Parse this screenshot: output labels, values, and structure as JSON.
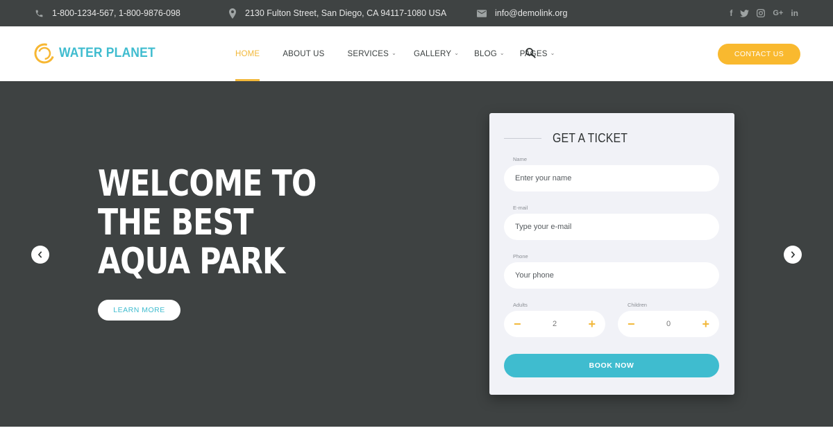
{
  "topbar": {
    "phone": "1-800-1234-567,  1-800-9876-098",
    "address": "2130 Fulton Street, San Diego, CA 94117-1080 USA",
    "email": "info@demolink.org",
    "social_icons": [
      "facebook-icon",
      "twitter-icon",
      "instagram-icon",
      "google-plus-icon",
      "linkedin-icon"
    ],
    "social_glyphs": {
      "facebook": "f",
      "googleplus": "G+",
      "linkedin": "in"
    }
  },
  "header": {
    "logo_text": "WATER PLANET",
    "nav": [
      {
        "label": "HOME",
        "active": true
      },
      {
        "label": "ABOUT US"
      },
      {
        "label": "SERVICES",
        "dropdown": true
      },
      {
        "label": "GALLERY",
        "dropdown": true
      },
      {
        "label": "BLOG",
        "dropdown": true
      },
      {
        "label": "PAGES",
        "dropdown": true
      }
    ],
    "contact_label": "CONTACT US"
  },
  "hero": {
    "title_line1": "WELCOME TO",
    "title_line2": "THE BEST",
    "title_line3": "AQUA PARK",
    "learn_more_label": "LEARN MORE"
  },
  "ticket": {
    "title": "GET A TICKET",
    "name_label": "Name",
    "name_placeholder": "Enter your name",
    "email_label": "E-mail",
    "email_placeholder": "Type your e-mail",
    "phone_label": "Phone",
    "phone_placeholder": "Your phone",
    "adults_label": "Adults",
    "adults_value": "2",
    "children_label": "Children",
    "children_value": "0",
    "book_label": "BOOK NOW"
  },
  "colors": {
    "accent_yellow": "#f9b92f",
    "accent_cyan": "#3fbccf",
    "hero_bg": "#3e4242",
    "topbar_bg": "#3f4343"
  }
}
